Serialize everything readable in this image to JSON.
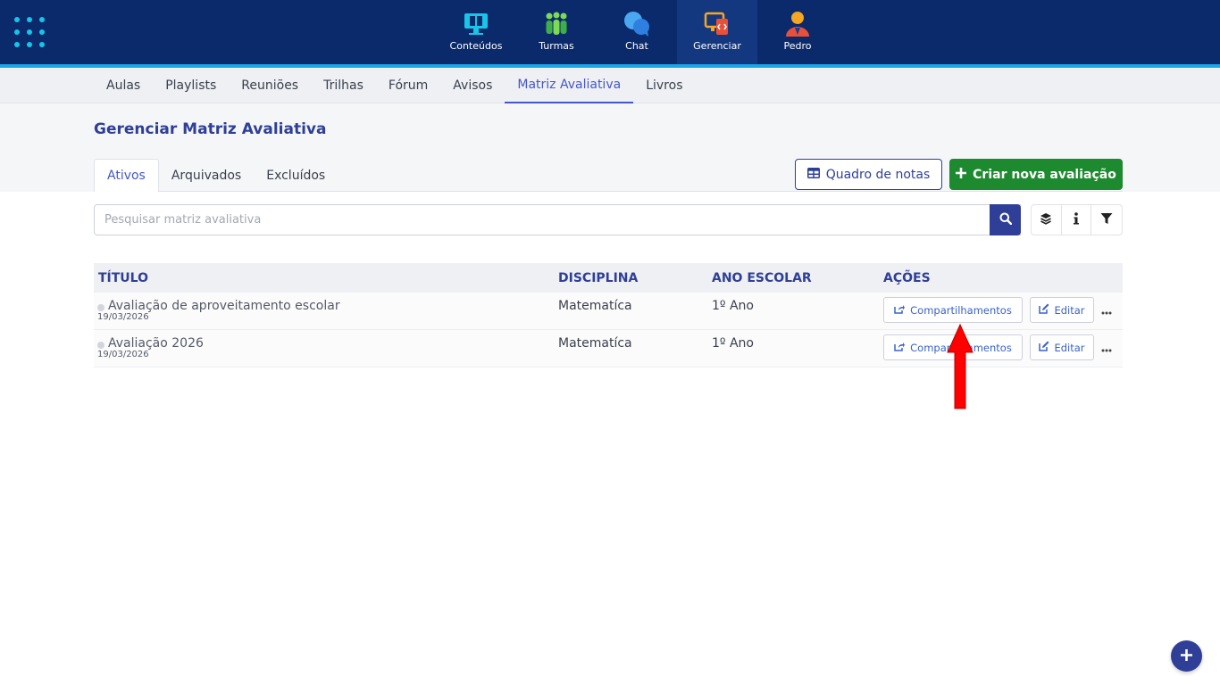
{
  "topbar": {
    "apps_icon": "apps-grid-icon",
    "items": [
      {
        "label": "Conteúdos",
        "icon": "monitor-book-icon"
      },
      {
        "label": "Turmas",
        "icon": "people-group-icon"
      },
      {
        "label": "Chat",
        "icon": "chat-bubbles-icon"
      },
      {
        "label": "Gerenciar",
        "icon": "manage-devices-icon",
        "active": true
      },
      {
        "label": "Pedro",
        "icon": "user-avatar-icon"
      }
    ],
    "colors": {
      "background": "#0b2a6b",
      "accent": "#1aa6e8"
    }
  },
  "subnav": {
    "items": [
      "Aulas",
      "Playlists",
      "Reuniões",
      "Trilhas",
      "Fórum",
      "Avisos",
      "Matriz Avaliativa",
      "Livros"
    ],
    "active": "Matriz Avaliativa"
  },
  "page": {
    "title": "Gerenciar Matriz Avaliativa",
    "tabs": [
      "Ativos",
      "Arquivados",
      "Excluídos"
    ],
    "active_tab": "Ativos",
    "quadro_button": "Quadro de notas",
    "criar_button": "Criar nova avaliação"
  },
  "search": {
    "placeholder": "Pesquisar matriz avaliativa",
    "value": ""
  },
  "table": {
    "headers": [
      "TÍTULO",
      "DISCIPLINA",
      "ANO ESCOLAR",
      "AÇÕES"
    ],
    "rows": [
      {
        "title": "Avaliação de aproveitamento escolar",
        "date": "19/03/2026",
        "disciplina": "Matematíca",
        "ano": "1º Ano",
        "share_label": "Compartilhamentos",
        "edit_label": "Editar"
      },
      {
        "title": "Avaliação 2026",
        "date": "19/03/2026",
        "disciplina": "Matematíca",
        "ano": "1º Ano",
        "share_label": "Compartilhamentos",
        "edit_label": "Editar"
      }
    ]
  },
  "annotation": {
    "arrow_color": "#ff0000",
    "icon": "red-up-arrow"
  },
  "colors": {
    "primary": "#2f3f97",
    "success": "#1e8a2f",
    "link": "#3b62c9"
  }
}
